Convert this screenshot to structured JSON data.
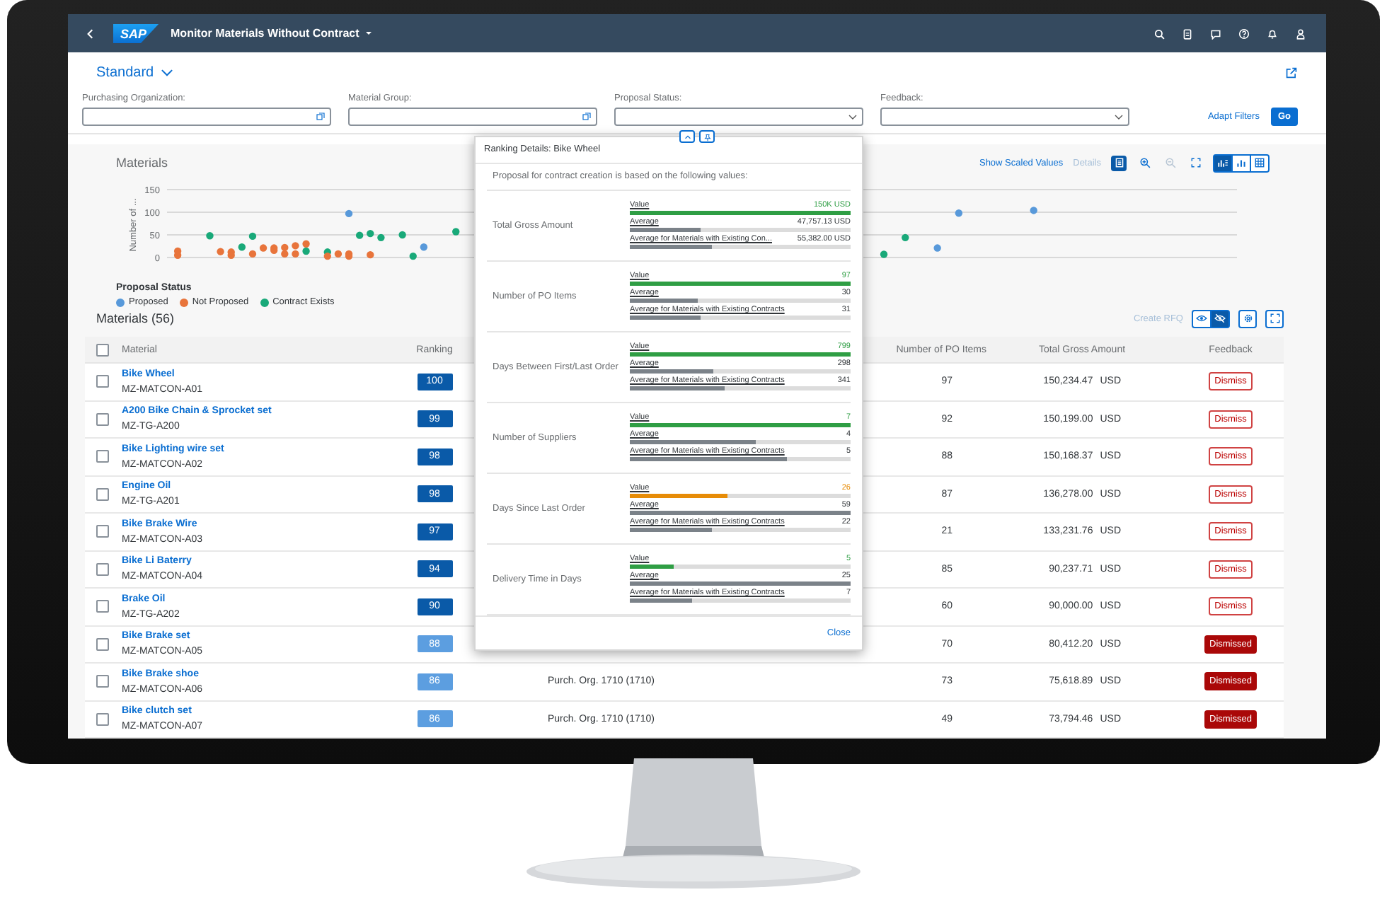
{
  "shell": {
    "logo": "SAP",
    "title": "Monitor Materials Without Contract"
  },
  "variant": "Standard",
  "filters": [
    {
      "label": "Purchasing Organization:",
      "kind": "valuehelp"
    },
    {
      "label": "Material Group:",
      "kind": "valuehelp"
    },
    {
      "label": "Proposal Status:",
      "kind": "select"
    },
    {
      "label": "Feedback:",
      "kind": "select"
    }
  ],
  "filter_actions": {
    "adapt": "Adapt Filters",
    "go": "Go"
  },
  "chart_panel": {
    "title": "Materials",
    "actions": [
      {
        "label": "Show Scaled Values",
        "disabled": false
      },
      {
        "label": "Details",
        "disabled": true
      }
    ],
    "tools": [
      {
        "kind": "legend",
        "selected": true,
        "disabled": false
      },
      {
        "kind": "zoom-in",
        "selected": false,
        "disabled": false
      },
      {
        "kind": "zoom-out",
        "selected": false,
        "disabled": true
      },
      {
        "kind": "fullscreen",
        "selected": false,
        "disabled": false
      }
    ],
    "views": [
      {
        "kind": "combined",
        "selected": true
      },
      {
        "kind": "chart",
        "selected": false
      },
      {
        "kind": "table",
        "selected": false
      }
    ],
    "y_title": "Number of ...",
    "y_ticks": [
      "150",
      "100",
      "50",
      "0"
    ],
    "legend_title": "Proposal Status",
    "legend": [
      {
        "name": "Proposed",
        "color": "#5899da"
      },
      {
        "name": "Not Proposed",
        "color": "#e8743b"
      },
      {
        "name": "Contract Exists",
        "color": "#19a979"
      }
    ]
  },
  "table": {
    "title": "Materials (56)",
    "create": {
      "label": "Create RFQ",
      "disabled": true
    },
    "tools": [
      {
        "kind": "eye",
        "selected": false
      },
      {
        "kind": "eye-slash",
        "selected": true
      },
      {
        "kind": "settings",
        "selected": false
      },
      {
        "kind": "fullscreen",
        "selected": false
      }
    ],
    "select_all": {
      "checked": false
    },
    "columns": [
      "Material",
      "Ranking",
      "Number of PO Items",
      "Total Gross Amount",
      "Feedback"
    ],
    "rows": [
      {
        "name": "Bike Wheel",
        "id": "MZ-MATCON-A01",
        "ranking": "100",
        "po_items": "97",
        "amount": "150,234.47",
        "currency": "USD",
        "feedback": "Dismiss",
        "dismissed": false,
        "checked": false
      },
      {
        "name": "A200 Bike Chain & Sprocket set",
        "id": "MZ-TG-A200",
        "ranking": "99",
        "po_items": "92",
        "amount": "150,199.00",
        "currency": "USD",
        "feedback": "Dismiss",
        "dismissed": false,
        "checked": false
      },
      {
        "name": "Bike Lighting wire set",
        "id": "MZ-MATCON-A02",
        "ranking": "98",
        "po_items": "88",
        "amount": "150,168.37",
        "currency": "USD",
        "feedback": "Dismiss",
        "dismissed": false,
        "checked": false
      },
      {
        "name": "Engine Oil",
        "id": "MZ-TG-A201",
        "ranking": "98",
        "po_items": "87",
        "amount": "136,278.00",
        "currency": "USD",
        "feedback": "Dismiss",
        "dismissed": false,
        "checked": false
      },
      {
        "name": "Bike Brake Wire",
        "id": "MZ-MATCON-A03",
        "ranking": "97",
        "po_items": "21",
        "amount": "133,231.76",
        "currency": "USD",
        "feedback": "Dismiss",
        "dismissed": false,
        "checked": false
      },
      {
        "name": "Bike Li Baterry",
        "id": "MZ-MATCON-A04",
        "ranking": "94",
        "po_items": "85",
        "amount": "90,237.71",
        "currency": "USD",
        "feedback": "Dismiss",
        "dismissed": false,
        "checked": false
      },
      {
        "name": "Brake Oil",
        "id": "MZ-TG-A202",
        "ranking": "90",
        "po_items": "60",
        "amount": "90,000.00",
        "currency": "USD",
        "feedback": "Dismiss",
        "dismissed": false,
        "checked": false
      },
      {
        "name": "Bike Brake set",
        "id": "MZ-MATCON-A05",
        "ranking": "88",
        "po_items": "70",
        "amount": "80,412.20",
        "currency": "USD",
        "feedback": "Dismissed",
        "dismissed": true,
        "checked": false
      },
      {
        "name": "Bike Brake shoe",
        "id": "MZ-MATCON-A06",
        "ranking": "86",
        "column_3": "Purch. Org. 1710 (1710)",
        "po_items": "73",
        "amount": "75,618.89",
        "currency": "USD",
        "feedback": "Dismissed",
        "dismissed": true,
        "checked": false
      },
      {
        "name": "Bike clutch set",
        "id": "MZ-MATCON-A07",
        "ranking": "86",
        "column_3": "Purch. Org. 1710 (1710)",
        "po_items": "49",
        "amount": "73,794.46",
        "currency": "USD",
        "feedback": "Dismissed",
        "dismissed": true,
        "checked": false
      }
    ]
  },
  "popover": {
    "title": "Ranking Details: Bike Wheel",
    "intro": "Proposal for contract creation is based on the following values:",
    "close": "Close",
    "metrics": [
      {
        "name": "Total Gross Amount",
        "color": "#2f9e44",
        "rows": [
          {
            "label": "Value",
            "value": "150K USD",
            "level": 1
          },
          {
            "label": "Average",
            "value": "47,757.13 USD",
            "level": 0.32
          },
          {
            "label": "Average for Materials with Existing Con...",
            "value": "55,382.00 USD",
            "level": 0.37
          }
        ]
      },
      {
        "name": "Number of PO Items",
        "color": "#2f9e44",
        "rows": [
          {
            "label": "Value",
            "value": "97",
            "level": 1
          },
          {
            "label": "Average",
            "value": "30",
            "level": 0.31
          },
          {
            "label": "Average for Materials with Existing Contracts",
            "value": "31",
            "level": 0.32
          }
        ]
      },
      {
        "name": "Days Between First/Last Order",
        "color": "#2f9e44",
        "rows": [
          {
            "label": "Value",
            "value": "799",
            "level": 1
          },
          {
            "label": "Average",
            "value": "298",
            "level": 0.38
          },
          {
            "label": "Average for Materials with Existing Contracts",
            "value": "341",
            "level": 0.43
          }
        ]
      },
      {
        "name": "Number of Suppliers",
        "color": "#2f9e44",
        "rows": [
          {
            "label": "Value",
            "value": "7",
            "level": 1
          },
          {
            "label": "Average",
            "value": "4",
            "level": 0.57
          },
          {
            "label": "Average for Materials with Existing Contracts",
            "value": "5",
            "level": 0.71
          }
        ]
      },
      {
        "name": "Days Since Last Order",
        "color": "#e78c07",
        "rows": [
          {
            "label": "Value",
            "value": "26",
            "level": 0.44
          },
          {
            "label": "Average",
            "value": "59",
            "level": 1
          },
          {
            "label": "Average for Materials with Existing Contracts",
            "value": "22",
            "level": 0.37
          }
        ]
      },
      {
        "name": "Delivery Time in Days",
        "color": "#2f9e44",
        "rows": [
          {
            "label": "Value",
            "value": "5",
            "level": 0.2
          },
          {
            "label": "Average",
            "value": "25",
            "level": 1
          },
          {
            "label": "Average for Materials with Existing Contracts",
            "value": "7",
            "level": 0.28
          }
        ]
      }
    ]
  }
}
